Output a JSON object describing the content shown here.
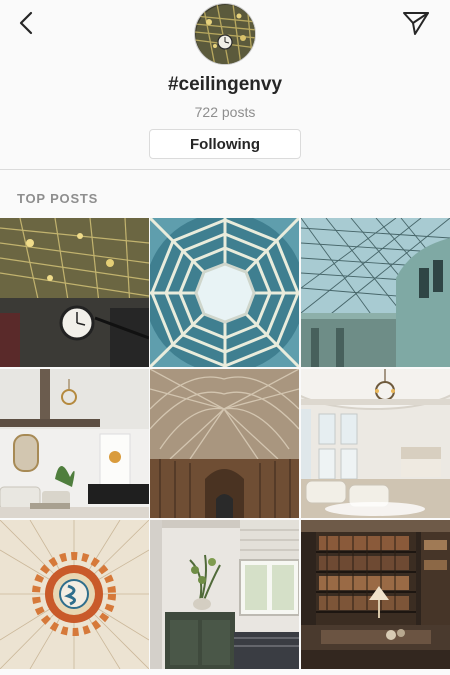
{
  "header": {
    "hashtag": "#ceilingenvy",
    "posts_count": "722 posts",
    "follow_label": "Following"
  },
  "section": {
    "title": "TOP POSTS"
  },
  "posts": [
    {
      "subject": "gold leaf ceiling with clock"
    },
    {
      "subject": "octagonal glass dome skylight"
    },
    {
      "subject": "glass canopy roof over courtyard"
    },
    {
      "subject": "white living room with beams"
    },
    {
      "subject": "fan vaulted gothic ceiling"
    },
    {
      "subject": "round bedroom with chandelier"
    },
    {
      "subject": "painted sun ceiling medallion"
    },
    {
      "subject": "kitchen with window and plant"
    },
    {
      "subject": "library with bookshelves"
    }
  ],
  "colors": {
    "background": "#fafafa",
    "text_primary": "#262626",
    "text_secondary": "#8e8e8e",
    "border": "#dbdbdb"
  }
}
